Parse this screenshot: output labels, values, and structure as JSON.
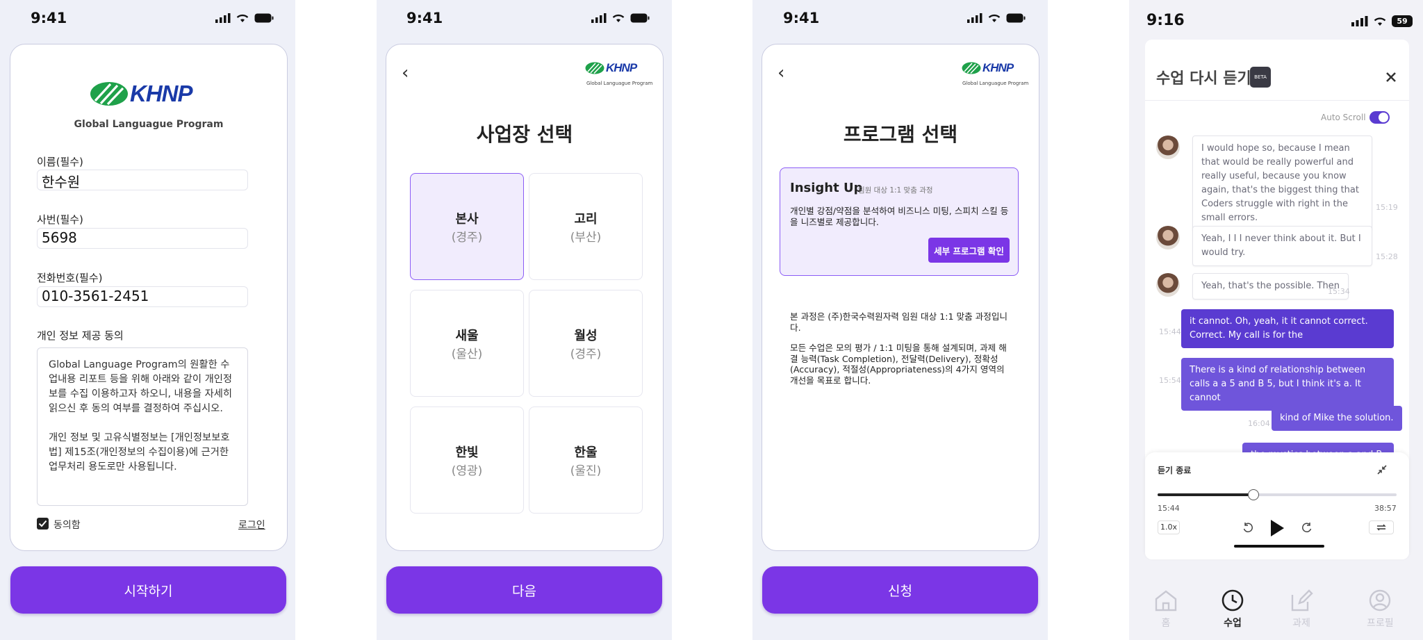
{
  "screen1": {
    "time": "9:41",
    "brand": "KHNP",
    "subtitle": "Global Languague Program",
    "name_label": "이름(필수)",
    "name_value": "한수원",
    "id_label": "사번(필수)",
    "id_value": "5698",
    "phone_label": "전화번호(필수)",
    "phone_value": "010-3561-2451",
    "consent_title": "개인 정보 제공 동의",
    "consent_text_1": "Global Language Program의 원활한 수업내용 리포트 등을 위해 아래와 같이 개인정보를 수집 이용하고자 하오니, 내용을 자세히 읽으신 후 동의 여부를 결정하여 주십시오.",
    "consent_text_2": "개인 정보 및 고유식별정보는 [개인정보보호법] 제15조(개인정보의 수집이용)에 근거한 업무처리 용도로만 사용됩니다.",
    "agree_label": "동의함",
    "agree_checked": true,
    "login_link": "로그인",
    "start_button": "시작하기"
  },
  "screen2": {
    "time": "9:41",
    "brand": "KHNP",
    "subtitle": "Global Languague Program",
    "title": "사업장 선택",
    "sites": [
      {
        "name": "본사",
        "sub": "(경주)",
        "selected": true
      },
      {
        "name": "고리",
        "sub": "(부산)",
        "selected": false
      },
      {
        "name": "새울",
        "sub": "(울산)",
        "selected": false
      },
      {
        "name": "월성",
        "sub": "(경주)",
        "selected": false
      },
      {
        "name": "한빛",
        "sub": "(영광)",
        "selected": false
      },
      {
        "name": "한울",
        "sub": "(울진)",
        "selected": false
      }
    ],
    "next_button": "다음"
  },
  "screen3": {
    "time": "9:41",
    "brand": "KHNP",
    "subtitle": "Global Languague Program",
    "title": "프로그램 선택",
    "program_name": "Insight Up",
    "program_tag": "임원 대상 1:1 맞춤 과정",
    "program_desc": "개인별 강점/약점을 분석하여 비즈니스 미팅, 스피치 스킬 등을 니즈별로 제공합니다.",
    "detail_button": "세부 프로그램 확인",
    "info_1": "본 과정은 (주)한국수력원자력 임원 대상 1:1 맞춤 과정입니다.",
    "info_2": "모든 수업은 모의 평가 / 1:1 미팅을 통해 설계되며, 과제 해결 능력(Task Completion), 전달력(Delivery), 정확성(Accuracy), 적절성(Appropriateness)의 4가지 영역의 개선을 목표로 합니다.",
    "apply_button": "신청"
  },
  "screen4": {
    "time": "9:16",
    "battery": "59",
    "title": "수업 다시 듣기",
    "beta": "BETA",
    "auto_scroll_label": "Auto Scroll",
    "auto_scroll_on": true,
    "messages": [
      {
        "side": "in",
        "text": "I would hope so, because I mean that would be really powerful and really useful, because you know again, that's the biggest thing that Coders struggle with right in the small errors.",
        "time": "15:19"
      },
      {
        "side": "in",
        "text": "Yeah, I I I never think about it. But I would try.",
        "time": "15:28"
      },
      {
        "side": "in",
        "text": "Yeah, that's the possible. Then",
        "time": "15:34"
      },
      {
        "side": "out",
        "text": "it cannot. Oh, yeah, it it cannot correct. Correct. My call is for the",
        "time": "15:44"
      },
      {
        "side": "out",
        "text": "There is a kind of relationship between calls a a 5 and B 5, but I think it's a. It cannot",
        "time": "15:54"
      },
      {
        "side": "out",
        "text": "kind of Mike the solution.",
        "time": "16:04"
      },
      {
        "side": "out",
        "text": "the mystics between a and B. But",
        "time": ""
      }
    ],
    "player": {
      "title": "듣기 종료",
      "current": "15:44",
      "total": "38:57",
      "progress": 0.4,
      "speed": "1.0x"
    },
    "tabs": [
      {
        "label": "홈",
        "icon": "home-icon",
        "active": false
      },
      {
        "label": "수업",
        "icon": "clock-icon",
        "active": true
      },
      {
        "label": "과제",
        "icon": "edit-icon",
        "active": false
      },
      {
        "label": "프로필",
        "icon": "profile-icon",
        "active": false
      }
    ]
  },
  "colors": {
    "primary": "#7b36e6",
    "brand_blue": "#1a3aa8",
    "brand_green": "#1fa14a",
    "chat_out": "#5a3bd1",
    "background": "#eef0f8"
  }
}
